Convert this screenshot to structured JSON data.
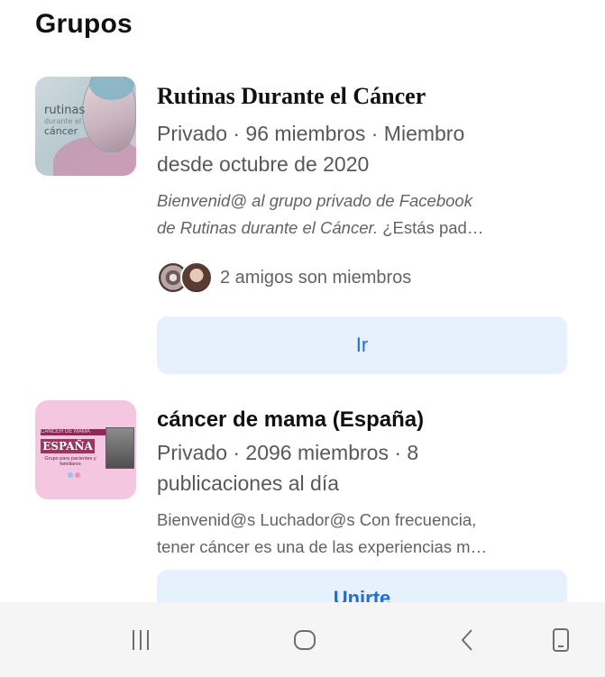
{
  "section": {
    "title": "Grupos"
  },
  "groups": [
    {
      "name": "Rutinas Durante el Cáncer",
      "meta_line1": "Privado · 96 miembros · Miembro",
      "meta_line2": "desde octubre de 2020",
      "description_line1": "Bienvenid@ al grupo privado de Facebook",
      "description_line2_italic": "de Rutinas durante el Cáncer.",
      "description_line2_rest": " ¿Estás pad…",
      "thumbnail_text": [
        "rutinas",
        "durante el",
        "cáncer"
      ],
      "friends_text": "2 amigos son miembros",
      "action_label": "Ir"
    },
    {
      "name": "cáncer de mama (España)",
      "meta_line1": "Privado · 2096 miembros · 8",
      "meta_line2": "publicaciones al día",
      "description_line1": "Bienvenid@s Luchador@s Con frecuencia,",
      "description_line2": "tener cáncer es una de las experiencias m…",
      "thumbnail_text": [
        "CÁNCER DE MAMA",
        "ESPAÑA",
        "Grupo para pacientes y familiares"
      ],
      "action_label": "Unirte"
    }
  ],
  "navbar": {
    "recents_icon": "recents-icon",
    "home_icon": "home-icon",
    "back_icon": "back-icon",
    "rotate_icon": "rotate-screen-icon"
  },
  "colors": {
    "accent_blue": "#1b6fd6",
    "button_bg": "#e6f1fd",
    "navbar_bg": "#f5f5f5"
  }
}
